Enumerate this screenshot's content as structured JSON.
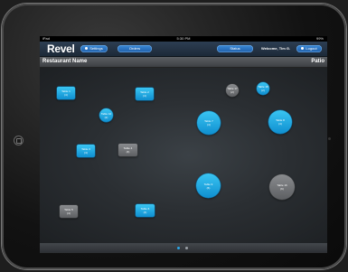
{
  "status_bar": {
    "carrier": "iPad",
    "time": "5:30 PM",
    "battery": "99%"
  },
  "header": {
    "logo": "Revel",
    "settings_label": "Settings",
    "orders_label": "Orders",
    "status_label": "Status",
    "welcome": "Welcome, Tim G.",
    "logout_label": "Logout"
  },
  "section": {
    "restaurant_name": "Restaurant Name",
    "area": "Patio"
  },
  "tables": [
    {
      "label": "Table 1",
      "seats": "(4)",
      "shape": "square",
      "color": "blue"
    },
    {
      "label": "Table 2",
      "seats": "(4)",
      "shape": "square",
      "color": "blue"
    },
    {
      "label": "Table 10",
      "seats": "(2)",
      "shape": "round",
      "color": "blue"
    },
    {
      "label": "Table 17",
      "seats": "(2)",
      "shape": "round",
      "color": "gray"
    },
    {
      "label": "Table 18",
      "seats": "(2)",
      "shape": "round",
      "color": "blue"
    },
    {
      "label": "Table 7",
      "seats": "(4)",
      "shape": "round",
      "color": "blue"
    },
    {
      "label": "Table 8",
      "seats": "(4)",
      "shape": "round",
      "color": "blue"
    },
    {
      "label": "Table 3",
      "seats": "(4)",
      "shape": "square",
      "color": "blue"
    },
    {
      "label": "Table 4",
      "seats": "(4)",
      "shape": "square",
      "color": "gray"
    },
    {
      "label": "Table 9",
      "seats": "(6)",
      "shape": "round",
      "color": "blue"
    },
    {
      "label": "Table 16",
      "seats": "(6)",
      "shape": "round",
      "color": "gray"
    },
    {
      "label": "Table 5",
      "seats": "(4)",
      "shape": "square",
      "color": "gray"
    },
    {
      "label": "Table 6",
      "seats": "(4)",
      "shape": "square",
      "color": "blue"
    }
  ],
  "pagination": {
    "pages": 2,
    "current": 1
  },
  "colors": {
    "header": "#1c2938",
    "accent": "#1f9fe0",
    "occupied": "#6d6f72"
  }
}
